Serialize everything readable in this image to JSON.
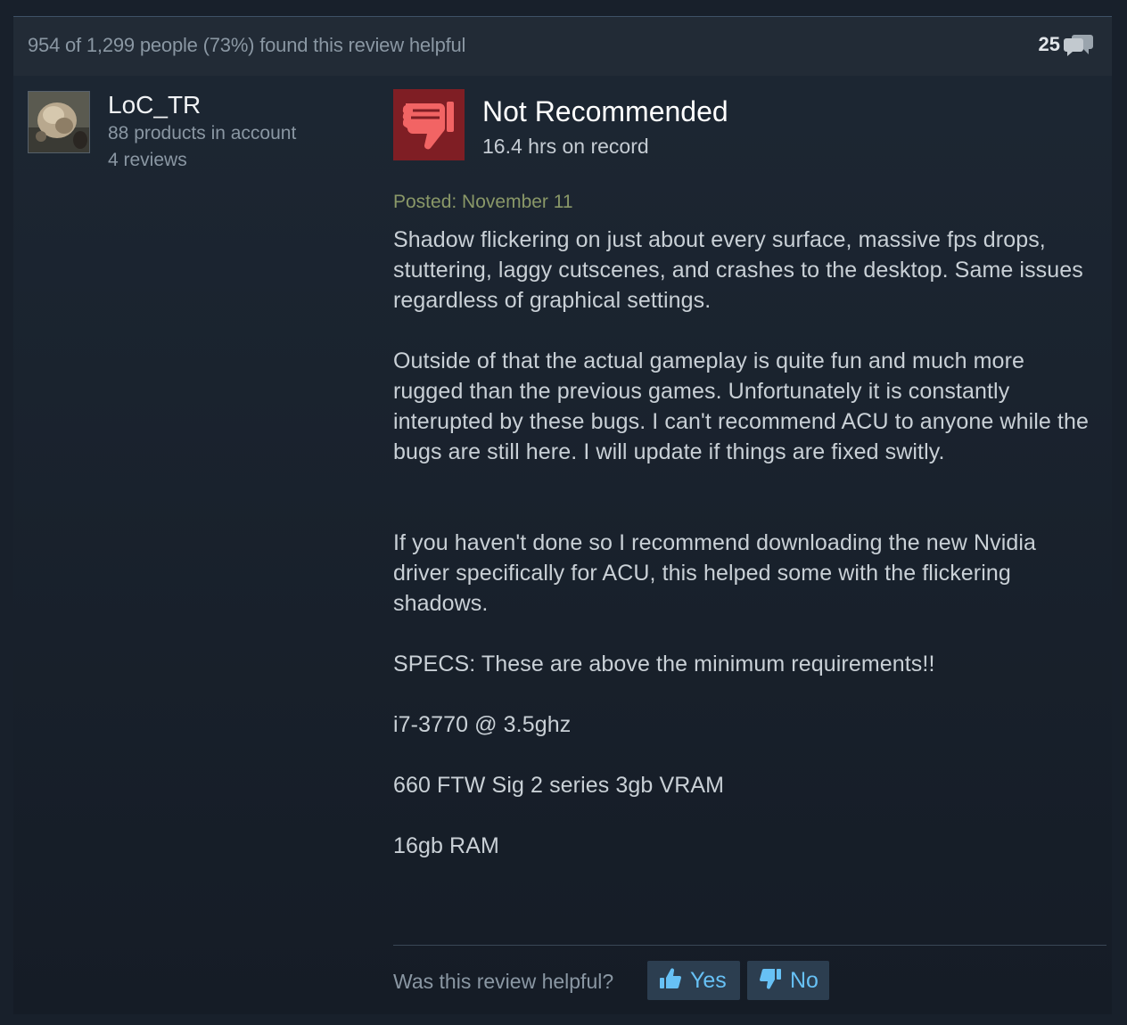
{
  "header": {
    "helpful_summary": "954 of 1,299 people (73%) found this review helpful",
    "comment_count": "25",
    "comment_icon": "speech-bubbles-icon"
  },
  "author": {
    "name": "LoC_TR",
    "products": "88 products in account",
    "reviews": "4 reviews",
    "avatar": "avatar-image"
  },
  "review": {
    "verdict": "Not Recommended",
    "verdict_icon": "thumbs-down-icon",
    "hours": "16.4 hrs on record",
    "posted": "Posted: November 11",
    "paragraphs": [
      "Shadow flickering on just about every surface, massive fps drops, stuttering, laggy cutscenes, and crashes to the desktop. Same issues regardless of graphical settings.",
      "Outside of that the actual gameplay is quite fun and much more rugged than the previous games. Unfortunately it is constantly interupted by these bugs. I can't recommend ACU to anyone while the bugs are still here. I will update if things are fixed switly.",
      "If you haven't done so I recommend downloading the new Nvidia driver specifically for ACU, this helped some with the flickering shadows.",
      "SPECS: These are above the minimum requirements!!",
      "i7-3770 @ 3.5ghz",
      "660 FTW Sig 2 series 3gb VRAM",
      "16gb RAM"
    ]
  },
  "feedback": {
    "question": "Was this review helpful?",
    "yes_label": "Yes",
    "no_label": "No"
  },
  "colors": {
    "background": "#18202b",
    "negative": "#7f1e24",
    "link": "#67c1f5",
    "posted": "#8a9868"
  }
}
